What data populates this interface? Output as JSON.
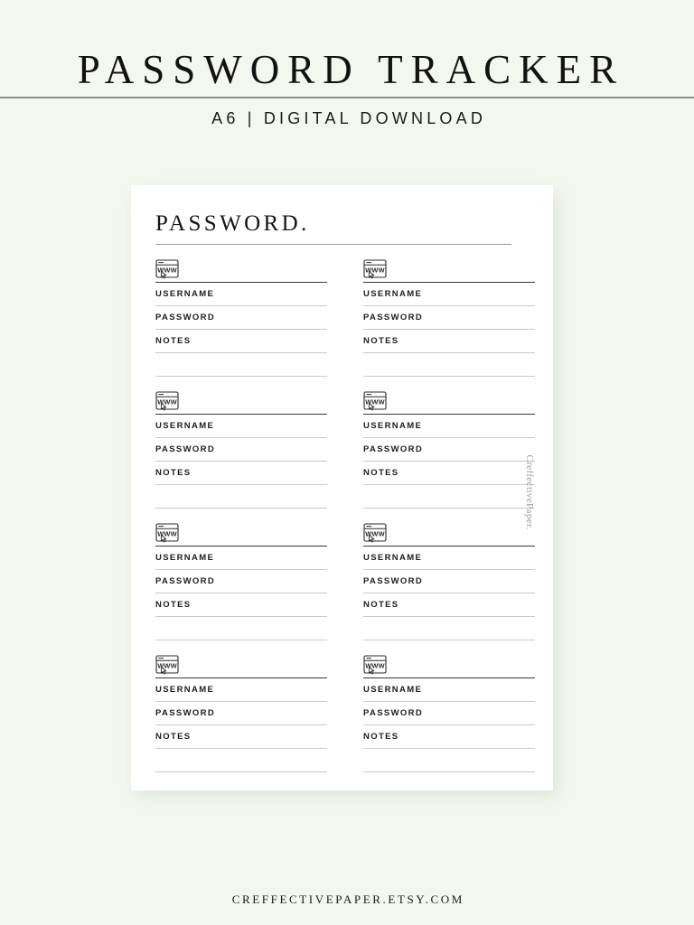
{
  "header": {
    "title": "PASSWORD TRACKER",
    "subtitle": "A6 | DIGITAL DOWNLOAD"
  },
  "card": {
    "title": "PASSWORD.",
    "field_labels": {
      "username": "USERNAME",
      "password": "PASSWORD",
      "notes": "NOTES"
    },
    "site_icon": "www-browser-icon",
    "icon_text": "WWW",
    "entries": [
      {
        "website": "",
        "username": "",
        "password": "",
        "notes": ""
      },
      {
        "website": "",
        "username": "",
        "password": "",
        "notes": ""
      },
      {
        "website": "",
        "username": "",
        "password": "",
        "notes": ""
      },
      {
        "website": "",
        "username": "",
        "password": "",
        "notes": ""
      },
      {
        "website": "",
        "username": "",
        "password": "",
        "notes": ""
      },
      {
        "website": "",
        "username": "",
        "password": "",
        "notes": ""
      },
      {
        "website": "",
        "username": "",
        "password": "",
        "notes": ""
      },
      {
        "website": "",
        "username": "",
        "password": "",
        "notes": ""
      }
    ]
  },
  "watermark": "CreffectivePaper.",
  "footer": "CREFFECTIVEPAPER.ETSY.COM",
  "colors": {
    "background": "#f3f7ef",
    "card": "#ffffff",
    "rule": "#8d9389",
    "text": "#151515",
    "line_strong": "#3a3a3a",
    "line_soft": "#c9c9c9"
  }
}
